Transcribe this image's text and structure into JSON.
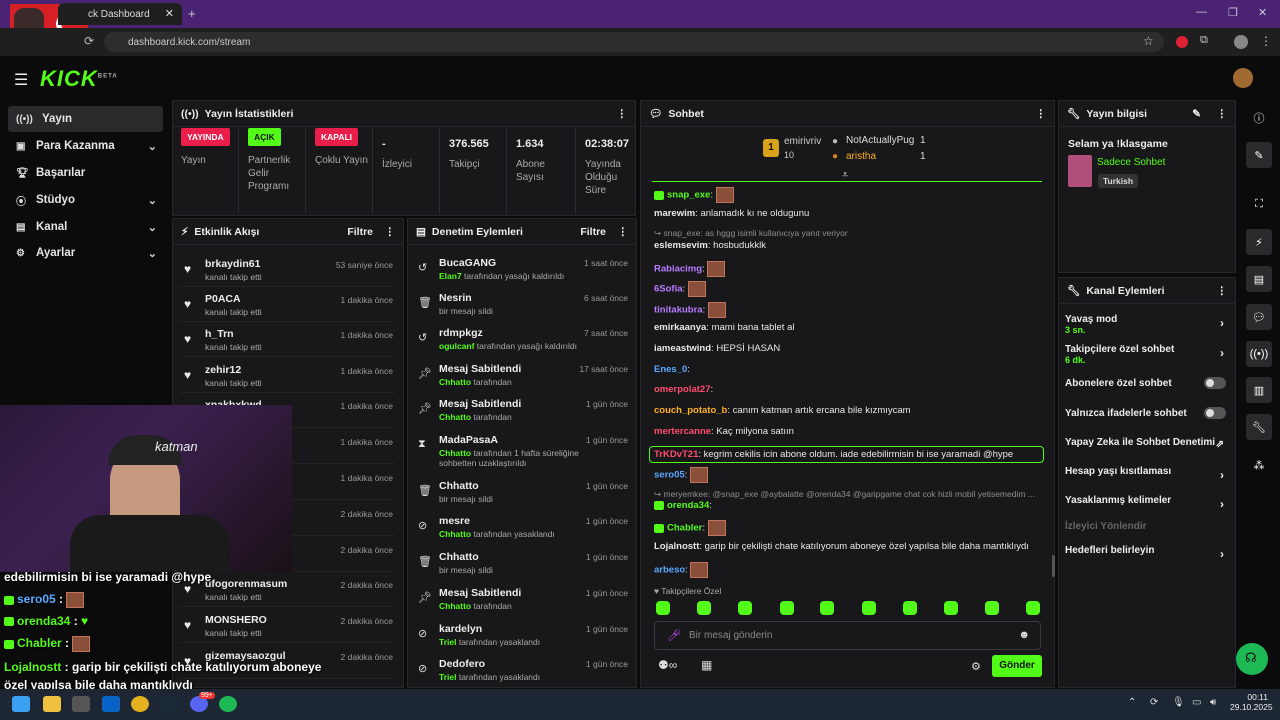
{
  "browser": {
    "tab_title": "ck Dashboard",
    "url": "dashboard.kick.com/stream"
  },
  "logo": {
    "text": "KICK",
    "tag": "BETA"
  },
  "nav": [
    {
      "label": "Yayın",
      "icon": "broadcast-icon"
    },
    {
      "label": "Para Kazanma",
      "icon": "money-icon"
    },
    {
      "label": "Başarılar",
      "icon": "trophy-icon"
    },
    {
      "label": "Stüdyo",
      "icon": "studio-icon"
    },
    {
      "label": "Kanal",
      "icon": "channel-icon"
    },
    {
      "label": "Ayarlar",
      "icon": "gear-icon"
    }
  ],
  "stats": {
    "title": "Yayın İstatistikleri",
    "cols": [
      {
        "badge": "YAYINDA",
        "label": "Yayın",
        "badge_color": "#e91e4a"
      },
      {
        "badge": "AÇIK",
        "label": "Partnerlik Gelir Programı",
        "badge_color": "#53fc18"
      },
      {
        "badge": "KAPALI",
        "label": "Çoklu Yayın",
        "badge_color": "#e91e4a"
      },
      {
        "value": "-",
        "label": "İzleyici"
      },
      {
        "value": "376.565",
        "label": "Takipçi"
      },
      {
        "value": "1.634",
        "label": "Abone Sayısı"
      },
      {
        "value": "02:38:07",
        "label": "Yayında Olduğu Süre"
      }
    ]
  },
  "activity": {
    "title": "Etkinlik Akışı",
    "filter": "Filtre",
    "items": [
      {
        "name": "brkaydin61",
        "sub": "kanalı takip etti",
        "time": "53 saniye önce"
      },
      {
        "name": "P0ACA",
        "sub": "kanalı takip etti",
        "time": "1 dakika önce"
      },
      {
        "name": "h_Trn",
        "sub": "kanalı takip etti",
        "time": "1 dakika önce"
      },
      {
        "name": "zehir12",
        "sub": "kanalı takip etti",
        "time": "1 dakika önce"
      },
      {
        "name": "xnakbxkwd",
        "sub": "",
        "time": "1 dakika önce"
      },
      {
        "name": "",
        "sub": "",
        "time": "1 dakika önce"
      },
      {
        "name": "",
        "sub": "",
        "time": "1 dakika önce"
      },
      {
        "name": "",
        "sub": "",
        "time": "2 dakika önce"
      },
      {
        "name": "",
        "sub": "",
        "time": "2 dakika önce"
      },
      {
        "name": "ufogorenmasum",
        "sub": "kanalı takip etti",
        "time": "2 dakika önce"
      },
      {
        "name": "MONSHERO",
        "sub": "kanalı takip etti",
        "time": "2 dakika önce"
      },
      {
        "name": "gizemaysaozgul",
        "sub": "",
        "time": "2 dakika önce"
      }
    ]
  },
  "moderation": {
    "title": "Denetim Eylemleri",
    "filter": "Filtre",
    "items": [
      {
        "name": "BucaGANG",
        "who": "Elan7",
        "rest": " tarafından yasağı kaldırıldı",
        "time": "1 saat önce",
        "icon": "undo-icon"
      },
      {
        "name": "Nesrin",
        "who": "",
        "rest": "bir mesajı sildi",
        "time": "6 saat önce",
        "icon": "trash-icon"
      },
      {
        "name": "rdmpkgz",
        "who": "ogulcanf",
        "rest": " tarafından yasağı kaldırıldı",
        "time": "7 saat önce",
        "icon": "undo-icon"
      },
      {
        "name": "Mesaj Sabitlendi",
        "who": "Chhatto",
        "rest": " tarafından",
        "time": "17 saat önce",
        "icon": "pin-icon"
      },
      {
        "name": "Mesaj Sabitlendi",
        "who": "Chhatto",
        "rest": " tarafından",
        "time": "1 gün önce",
        "icon": "pin-icon"
      },
      {
        "name": "MadaPasaA",
        "who": "Chhatto",
        "rest": " tarafından 1 hafta süreliğine sohbetten uzaklaştırıldı",
        "time": "1 gün önce",
        "icon": "hourglass-icon"
      },
      {
        "name": "Chhatto",
        "who": "",
        "rest": "bir mesajı sildi",
        "time": "1 gün önce",
        "icon": "trash-icon"
      },
      {
        "name": "mesre",
        "who": "Chhatto",
        "rest": " tarafından yasaklandı",
        "time": "1 gün önce",
        "icon": "ban-icon"
      },
      {
        "name": "Chhatto",
        "who": "",
        "rest": "bir mesajı sildi",
        "time": "1 gün önce",
        "icon": "trash-icon"
      },
      {
        "name": "Mesaj Sabitlendi",
        "who": "Chhatto",
        "rest": " tarafından",
        "time": "1 gün önce",
        "icon": "pin-icon"
      },
      {
        "name": "kardelyn",
        "who": "Triel",
        "rest": " tarafından yasaklandı",
        "time": "1 gün önce",
        "icon": "ban-icon"
      },
      {
        "name": "Dedofero",
        "who": "Triel",
        "rest": " tarafından yasaklandı",
        "time": "1 gün önce",
        "icon": "ban-icon"
      }
    ]
  },
  "chat": {
    "title": "Sohbet",
    "leaderboard": {
      "top": "emirivriv",
      "top_count": "10",
      "r2": "NotActuallyPug",
      "r2c": "1",
      "r3": "aristha",
      "r3c": "1"
    },
    "lines": [
      {
        "user": "snap_exe",
        "color": "#53fc18",
        "text": "",
        "emote": true
      },
      {
        "user": "marewim",
        "color": "#e8e8e8",
        "text": "anlamadık kı ne oldugunu",
        "emote": false
      },
      {
        "user": "eslemsevim",
        "color": "#e8e8e8",
        "text": "hosbudukklk",
        "emote": false,
        "reply": "snap_exe: as hggg isimli kullanıcıya yanıt veriyor"
      },
      {
        "user": "Rabiacimg",
        "color": "#b77cff",
        "text": "",
        "emote": true
      },
      {
        "user": "6Sofia",
        "color": "#b77cff",
        "text": "",
        "emote": true
      },
      {
        "user": "tinitakubra",
        "color": "#b77cff",
        "text": "",
        "emote": true
      },
      {
        "user": "emirkaanya",
        "color": "#e8e8e8",
        "text": "mami bana tablet al",
        "emote": false
      },
      {
        "user": "iameastwind",
        "color": "#e8e8e8",
        "text": "HEPSİ HASAN",
        "emote": false
      },
      {
        "user": "Enes_0",
        "color": "#5aa9ff",
        "text": "",
        "emote": false
      },
      {
        "user": "omerpolat27",
        "color": "#ff4d6d",
        "text": "",
        "emote": false
      },
      {
        "user": "couch_potato_b",
        "color": "#ffb020",
        "text": "canım katman artık ercana bile kızmıycam",
        "emote": false
      },
      {
        "user": "mertercanne",
        "color": "#ff4d6d",
        "text": "Kaç milyona satıın",
        "emote": false
      },
      {
        "user": "TrKDvT21",
        "color": "#ff4d6d",
        "text": "kegrim cekilis icin abone oldum. iade edebilirmisin bi ise yaramadi @hype",
        "emote": false,
        "highlight": true
      },
      {
        "user": "sero05",
        "color": "#5aa9ff",
        "text": "",
        "emote": true
      },
      {
        "user": "orenda34",
        "color": "#53fc18",
        "text": "",
        "emote": false,
        "reply": "meryemkee: @snap_exe @aybalatte @orenda34 @garipgame chat cok hizli mobil yetisemedim ..."
      },
      {
        "user": "Chabler",
        "color": "#53fc18",
        "text": "",
        "emote": true
      },
      {
        "user": "Lojalnostt",
        "color": "#e8e8e8",
        "text": "garip bir çekilişti chate katılıyorum aboneye özel yapılsa bile daha mantıklıydı",
        "emote": false
      },
      {
        "user": "arbeso",
        "color": "#5aa9ff",
        "text": "",
        "emote": true
      }
    ],
    "followers_only": "Takipçilere Özel",
    "input_placeholder": "Bir mesaj gönderin",
    "send": "Gönder"
  },
  "info": {
    "title": "Yayın bilgisi",
    "stream_title": "Selam ya !klasgame",
    "category": "Sadece Sohbet",
    "language": "Turkish"
  },
  "channel_actions": {
    "title": "Kanal Eylemleri",
    "items": [
      {
        "label": "Yavaş mod",
        "sub": "3 sn.",
        "kind": "chev"
      },
      {
        "label": "Takipçilere özel sohbet",
        "sub": "6 dk.",
        "kind": "chev"
      },
      {
        "label": "Abonelere özel sohbet",
        "sub": "",
        "kind": "toggle"
      },
      {
        "label": "Yalnızca ifadelerle sohbet",
        "sub": "",
        "kind": "toggle"
      },
      {
        "label": "Yapay Zeka ile Sohbet Denetimi",
        "sub": "",
        "kind": "ext"
      },
      {
        "label": "Hesap yaşı kısıtlaması",
        "sub": "",
        "kind": "chev"
      },
      {
        "label": "Yasaklanmış kelimeler",
        "sub": "",
        "kind": "chev"
      },
      {
        "label": "İzleyici Yönlendir",
        "sub": "",
        "kind": "disabled"
      },
      {
        "label": "Hedefleri belirleyin",
        "sub": "",
        "kind": "chev"
      }
    ]
  },
  "overlay": {
    "line1": "edebilirmisin bi ise yaramadi @hype",
    "u1": "sero05",
    "u2": "orenda34",
    "u3": "Chabler",
    "u4": "Lojalnostt",
    "t4": "garip bir çekilişti chate katılıyorum aboneye",
    "t5": "özel yapılsa bile daha mantıklıydı",
    "cam_text": "katman"
  },
  "taskbar": {
    "time": "00:11",
    "date": "29.10.2025",
    "badge": "99+"
  }
}
